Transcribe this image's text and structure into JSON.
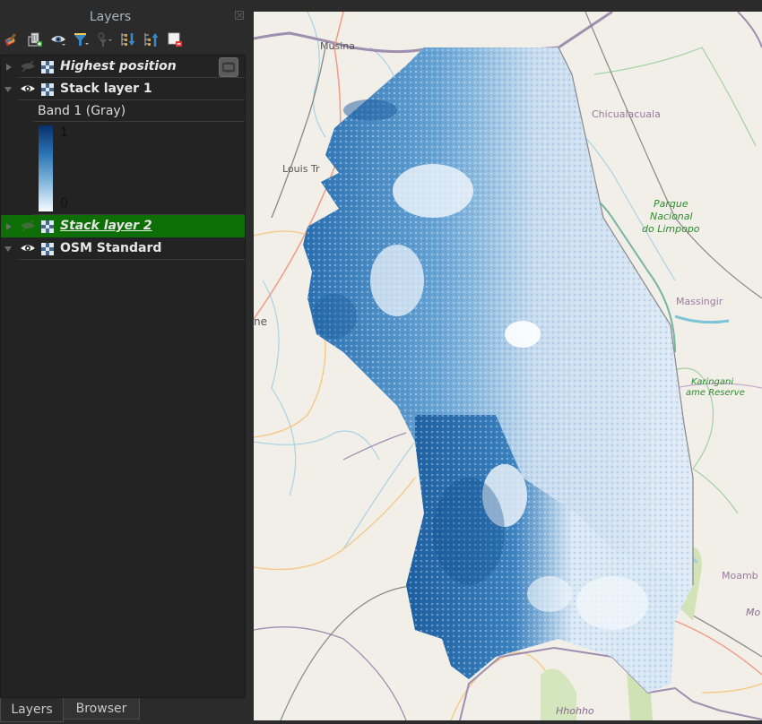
{
  "panel": {
    "title": "Layers",
    "toolbar": [
      {
        "name": "style-manager-icon",
        "tooltip": "Open Layer Styling"
      },
      {
        "name": "add-group-icon",
        "tooltip": "Add Group"
      },
      {
        "name": "manage-visibility-icon",
        "tooltip": "Manage Map Themes"
      },
      {
        "name": "filter-legend-icon",
        "tooltip": "Filter Legend"
      },
      {
        "name": "filter-expression-icon",
        "tooltip": "Filter by Expression"
      },
      {
        "name": "expand-all-icon",
        "tooltip": "Expand All"
      },
      {
        "name": "collapse-all-icon",
        "tooltip": "Collapse All"
      },
      {
        "name": "remove-layer-icon",
        "tooltip": "Remove Layer"
      }
    ],
    "layers": [
      {
        "name": "Highest position",
        "visible": false,
        "expanded": false,
        "italic": true,
        "selected": false
      },
      {
        "name": "Stack layer 1",
        "visible": true,
        "expanded": true,
        "italic": false,
        "selected": false,
        "legend": {
          "band_label": "Band 1 (Gray)",
          "max_label": "1",
          "min_label": "0",
          "ramp": [
            "#08306b",
            "#2c75b6",
            "#85b8dc",
            "#f7fbff"
          ]
        }
      },
      {
        "name": "Stack layer 2",
        "visible": false,
        "expanded": false,
        "italic": true,
        "selected": true
      },
      {
        "name": "OSM Standard",
        "visible": true,
        "expanded": true,
        "italic": false,
        "selected": false
      }
    ],
    "tabs": [
      {
        "label": "Layers",
        "active": true
      },
      {
        "label": "Browser",
        "active": false
      }
    ]
  },
  "map": {
    "labels": [
      {
        "text": "Musina",
        "color": "#555555",
        "style": "normal"
      },
      {
        "text": "Chicualacuala",
        "color": "#9a7aa0",
        "style": "normal"
      },
      {
        "text": "Louis Tr",
        "color": "#555555",
        "style": "normal"
      },
      {
        "text": "Parque",
        "color": "#2c8c2c",
        "style": "italic"
      },
      {
        "text": "Nacional",
        "color": "#2c8c2c",
        "style": "italic"
      },
      {
        "text": "do Limpopo",
        "color": "#2c8c2c",
        "style": "italic"
      },
      {
        "text": "Massingir",
        "color": "#9a7aa0",
        "style": "normal"
      },
      {
        "text": "Karingani",
        "color": "#2c8c2c",
        "style": "italic"
      },
      {
        "text": "ame Reserve",
        "color": "#2c8c2c",
        "style": "italic"
      },
      {
        "text": "ne",
        "color": "#555555",
        "style": "normal"
      },
      {
        "text": "Moamb",
        "color": "#9a7aa0",
        "style": "normal"
      },
      {
        "text": "Mo",
        "color": "#8a6a90",
        "style": "italic"
      },
      {
        "text": "Hhohho",
        "color": "#8a6a90",
        "style": "italic"
      }
    ],
    "colors": {
      "background": "#f2efe9",
      "country_border": "#9e8fb0",
      "river": "#a8d3e3",
      "road_primary": "#f19a84",
      "road_secondary": "#f5c77f",
      "park_border": "#9fd29f",
      "raster_dark": "#08519c",
      "raster_light": "#deebf7"
    }
  }
}
